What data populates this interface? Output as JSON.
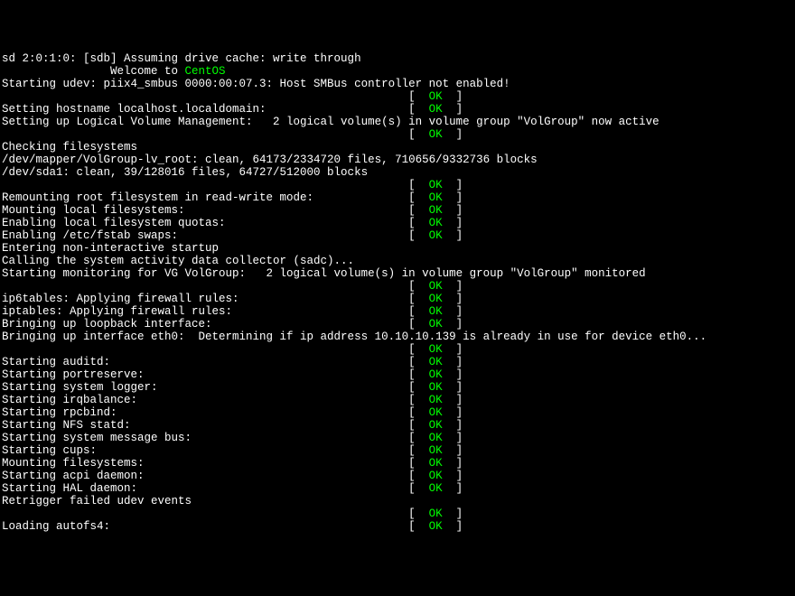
{
  "lines": [
    {
      "type": "text",
      "content": "sd 2:0:1:0: [sdb] Assuming drive cache: write through"
    },
    {
      "type": "welcome",
      "prefix": "                Welcome to ",
      "brand": "CentOS"
    },
    {
      "type": "text",
      "content": "Starting udev: piix4_smbus 0000:00:07.3: Host SMBus controller not enabled!"
    },
    {
      "type": "status",
      "label": "",
      "status": "OK"
    },
    {
      "type": "status",
      "label": "Setting hostname localhost.localdomain: ",
      "status": "OK"
    },
    {
      "type": "text",
      "content": "Setting up Logical Volume Management:   2 logical volume(s) in volume group \"VolGroup\" now active"
    },
    {
      "type": "status",
      "label": "",
      "status": "OK"
    },
    {
      "type": "text",
      "content": "Checking filesystems"
    },
    {
      "type": "text",
      "content": "/dev/mapper/VolGroup-lv_root: clean, 64173/2334720 files, 710656/9332736 blocks"
    },
    {
      "type": "text",
      "content": "/dev/sda1: clean, 39/128016 files, 64727/512000 blocks"
    },
    {
      "type": "status",
      "label": "",
      "status": "OK"
    },
    {
      "type": "status",
      "label": "Remounting root filesystem in read-write mode: ",
      "status": "OK"
    },
    {
      "type": "status",
      "label": "Mounting local filesystems: ",
      "status": "OK"
    },
    {
      "type": "status",
      "label": "Enabling local filesystem quotas: ",
      "status": "OK"
    },
    {
      "type": "status",
      "label": "Enabling /etc/fstab swaps: ",
      "status": "OK"
    },
    {
      "type": "text",
      "content": "Entering non-interactive startup"
    },
    {
      "type": "text",
      "content": "Calling the system activity data collector (sadc)..."
    },
    {
      "type": "text",
      "content": "Starting monitoring for VG VolGroup:   2 logical volume(s) in volume group \"VolGroup\" monitored"
    },
    {
      "type": "status",
      "label": "",
      "status": "OK"
    },
    {
      "type": "status",
      "label": "ip6tables: Applying firewall rules: ",
      "status": "OK"
    },
    {
      "type": "status",
      "label": "iptables: Applying firewall rules: ",
      "status": "OK"
    },
    {
      "type": "status",
      "label": "Bringing up loopback interface: ",
      "status": "OK"
    },
    {
      "type": "text",
      "content": "Bringing up interface eth0:  Determining if ip address 10.10.10.139 is already in use for device eth0..."
    },
    {
      "type": "status",
      "label": "",
      "status": "OK"
    },
    {
      "type": "status",
      "label": "Starting auditd: ",
      "status": "OK"
    },
    {
      "type": "status",
      "label": "Starting portreserve: ",
      "status": "OK"
    },
    {
      "type": "status",
      "label": "Starting system logger: ",
      "status": "OK"
    },
    {
      "type": "status",
      "label": "Starting irqbalance: ",
      "status": "OK"
    },
    {
      "type": "status",
      "label": "Starting rpcbind: ",
      "status": "OK"
    },
    {
      "type": "status",
      "label": "Starting NFS statd: ",
      "status": "OK"
    },
    {
      "type": "status",
      "label": "Starting system message bus: ",
      "status": "OK"
    },
    {
      "type": "status",
      "label": "Starting cups: ",
      "status": "OK"
    },
    {
      "type": "status",
      "label": "Mounting filesystems: ",
      "status": "OK"
    },
    {
      "type": "status",
      "label": "Starting acpi daemon: ",
      "status": "OK"
    },
    {
      "type": "status",
      "label": "Starting HAL daemon: ",
      "status": "OK"
    },
    {
      "type": "text",
      "content": "Retrigger failed udev events"
    },
    {
      "type": "status",
      "label": "",
      "status": "OK"
    },
    {
      "type": "status",
      "label": "Loading autofs4: ",
      "status": "OK"
    }
  ],
  "status_col": 60,
  "brackets": {
    "open": "[",
    "close": "]"
  }
}
